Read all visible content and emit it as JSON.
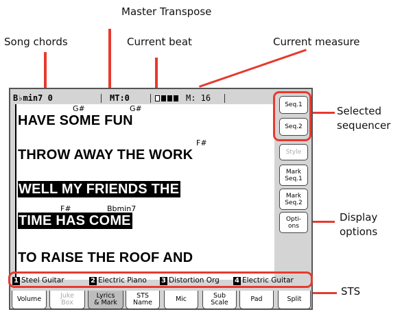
{
  "callouts": {
    "master_transpose": "Master Transpose",
    "song_chords": "Song chords",
    "current_beat": "Current beat",
    "current_measure": "Current measure",
    "selected_sequencer": "Selected\nsequencer",
    "display_options": "Display\noptions",
    "sts": "STS"
  },
  "status_bar": {
    "chord": "B♭min7 0",
    "master_transpose": "MT:0",
    "measure": "M: 16"
  },
  "lyrics": [
    {
      "text": "HAVE SOME FUN",
      "chords": [
        "G#",
        "G#"
      ],
      "highlighted": false
    },
    {
      "text": "THROW AWAY THE WORK",
      "chords": [
        "F#"
      ],
      "highlighted": false
    },
    {
      "text": "WELL MY FRIENDS THE",
      "chords": [],
      "highlighted": true
    },
    {
      "text": "TIME HAS COME",
      "chords": [
        "F#",
        "Bbmin7"
      ],
      "highlighted": true
    },
    {
      "text": "TO RAISE THE ROOF AND",
      "chords": [],
      "highlighted": false
    }
  ],
  "side_buttons": [
    {
      "label": "Seq.1",
      "enabled": true
    },
    {
      "label": "Seq.2",
      "enabled": true
    },
    {
      "label": "Style",
      "enabled": false
    },
    {
      "label": "Mark\nSeq.1",
      "enabled": true
    },
    {
      "label": "Mark\nSeq.2",
      "enabled": true
    },
    {
      "label": "Opti-\nons",
      "enabled": true
    }
  ],
  "sts": [
    {
      "num": "1",
      "name": "Steel Guitar"
    },
    {
      "num": "2",
      "name": "Electric Piano"
    },
    {
      "num": "3",
      "name": "Distortion Org"
    },
    {
      "num": "4",
      "name": "Electric Guitar"
    }
  ],
  "tabs": [
    {
      "label": "Volume",
      "enabled": true,
      "selected": false
    },
    {
      "label": "Juke\nBox",
      "enabled": false,
      "selected": false
    },
    {
      "label": "Lyrics\n& Mark",
      "enabled": true,
      "selected": true
    },
    {
      "label": "STS\nName",
      "enabled": true,
      "selected": false
    },
    {
      "label": "Mic",
      "enabled": true,
      "selected": false
    },
    {
      "label": "Sub\nScale",
      "enabled": true,
      "selected": false
    },
    {
      "label": "Pad",
      "enabled": true,
      "selected": false
    },
    {
      "label": "Split",
      "enabled": true,
      "selected": false
    }
  ],
  "colors": {
    "highlight": "#e63a2e"
  }
}
